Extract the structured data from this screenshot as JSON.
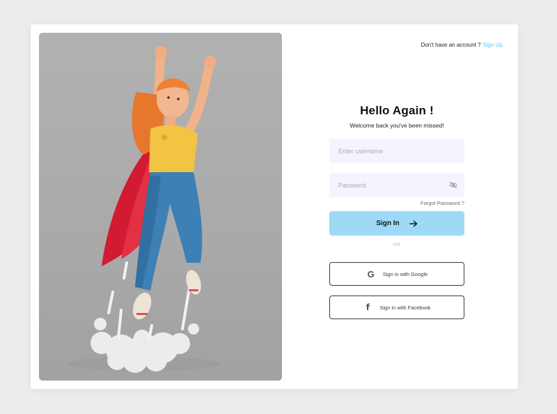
{
  "auth": {
    "signup_prompt": "Don't have an account ?",
    "signup_link": "Sign Up",
    "title": "Hello Again !",
    "subtitle": "Welcome back you've been missed!",
    "username_placeholder": "Enter username",
    "password_placeholder": "Password",
    "forgot_password": "Forgot Password ?",
    "signin_label": "Sign In",
    "divider": "OR",
    "google_label": "Sign in with Google",
    "facebook_label": "Sign in with Facebook",
    "google_icon": "G",
    "facebook_icon": "f"
  },
  "icons": {
    "password_toggle": "eye-off-icon",
    "signin_arrow": "arrow-right-icon",
    "google": "google-icon",
    "facebook": "facebook-icon"
  },
  "colors": {
    "accent_link": "#5fc0ec",
    "signin_button": "#9ed9f7",
    "input_bg": "#f4f4fd",
    "page_bg": "#ececec",
    "illustration_bg": "#aaaaaa"
  }
}
